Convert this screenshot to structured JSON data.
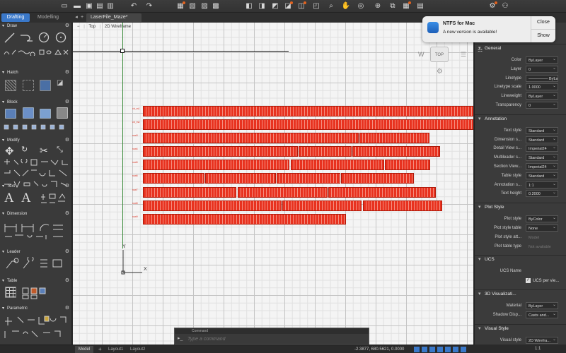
{
  "toolbar": {
    "icons": [
      "new-file-icon",
      "open-folder-icon",
      "save-icon",
      "save-as-icon",
      "cloud-save-icon",
      "print-icon",
      "publish-icon",
      "plot-icon",
      "undo-icon",
      "redo-icon",
      "layer-states-icon",
      "layer-isolate-icon",
      "layer-unisolate-icon",
      "layer-freeze-icon",
      "layer-match-icon",
      "pan-icon",
      "orbit-icon",
      "zoom-icon",
      "selection-cycling-icon",
      "gear-icon",
      "bell-icon",
      "user-icon",
      "attachment-icon"
    ]
  },
  "workspace_tabs": {
    "drafting": "Drafting",
    "modelling": "Modelling"
  },
  "file_tab": {
    "name": "LaserFile_Maze*",
    "add": "+"
  },
  "viewport": {
    "minus": "−",
    "view": "Top",
    "style": "2D Wireframe"
  },
  "viewcube": {
    "label": "TOP",
    "west": "W"
  },
  "palette": {
    "sections": [
      {
        "name": "Draw"
      },
      {
        "name": "Hatch"
      },
      {
        "name": "Block"
      },
      {
        "name": "Modify"
      },
      {
        "name": "Text"
      },
      {
        "name": "Dimension"
      },
      {
        "name": "Leader"
      },
      {
        "name": "Table"
      },
      {
        "name": "Parametric"
      }
    ]
  },
  "drawing": {
    "colors": {
      "bar": "#e8321f",
      "bar_border": "#b01a0a",
      "label": "#d92a1a",
      "axis_y": "#3a8a3a",
      "crosshair": "#111111"
    },
    "row_labels": [
      "cb_m1",
      "cb_m2",
      "row3",
      "row4",
      "row5",
      "row6",
      "row7",
      "row8",
      "row9"
    ],
    "ucs": {
      "y": "Y",
      "x": "X"
    }
  },
  "notification": {
    "title": "NTFS for Mac",
    "message": "A new version is available!",
    "close": "Close",
    "show": "Show"
  },
  "properties": {
    "general": {
      "title": "General",
      "rows": [
        {
          "label": "Color",
          "value": "ByLayer"
        },
        {
          "label": "Layer",
          "value": "0"
        },
        {
          "label": "Linetype",
          "value": "————— ByLay..."
        },
        {
          "label": "Linetype scale",
          "value": "1.0000"
        },
        {
          "label": "Lineweight",
          "value": "ByLayer"
        },
        {
          "label": "Transparency",
          "value": "0"
        }
      ]
    },
    "annotation": {
      "title": "Annotation",
      "rows": [
        {
          "label": "Text style",
          "value": "Standard"
        },
        {
          "label": "Dimension s...",
          "value": "Standard"
        },
        {
          "label": "Detail View s...",
          "value": "Imperial24"
        },
        {
          "label": "Multileader s...",
          "value": "Standard"
        },
        {
          "label": "Section View...",
          "value": "Imperial24"
        },
        {
          "label": "Table style",
          "value": "Standard"
        },
        {
          "label": "Annotation s...",
          "value": "1:1"
        },
        {
          "label": "Text height",
          "value": "0.2000"
        }
      ]
    },
    "plot": {
      "title": "Plot Style",
      "rows": [
        {
          "label": "Plot style",
          "value": "ByColor"
        },
        {
          "label": "Plot style table",
          "value": "None"
        },
        {
          "label": "Plot style att...",
          "value": "Model"
        },
        {
          "label": "Plot table type",
          "value": "Not available"
        }
      ]
    },
    "ucs": {
      "title": "UCS",
      "name_label": "UCS Name",
      "check_label": "UCS per vie..."
    },
    "viz": {
      "title": "3D Visualizati...",
      "rows": [
        {
          "label": "Material",
          "value": "ByLayer"
        },
        {
          "label": "Shadow Disp...",
          "value": "Casts and..."
        }
      ]
    },
    "visual": {
      "title": "Visual Style",
      "rows": [
        {
          "label": "Visual style",
          "value": "2D Wirefra..."
        }
      ]
    },
    "face": {
      "title": "Face Effects",
      "rows": [
        {
          "label": "Face Style",
          "value": "None"
        }
      ]
    }
  },
  "command": {
    "title": "Command",
    "placeholder": "Type a command",
    "prompt": "▸_"
  },
  "status": {
    "model_tab": "Model",
    "add": "+",
    "layout1": "Layout1",
    "layout2": "Layout2",
    "coords": "-2.3877, 680.5621, 0.0000",
    "scale": "1:1"
  }
}
